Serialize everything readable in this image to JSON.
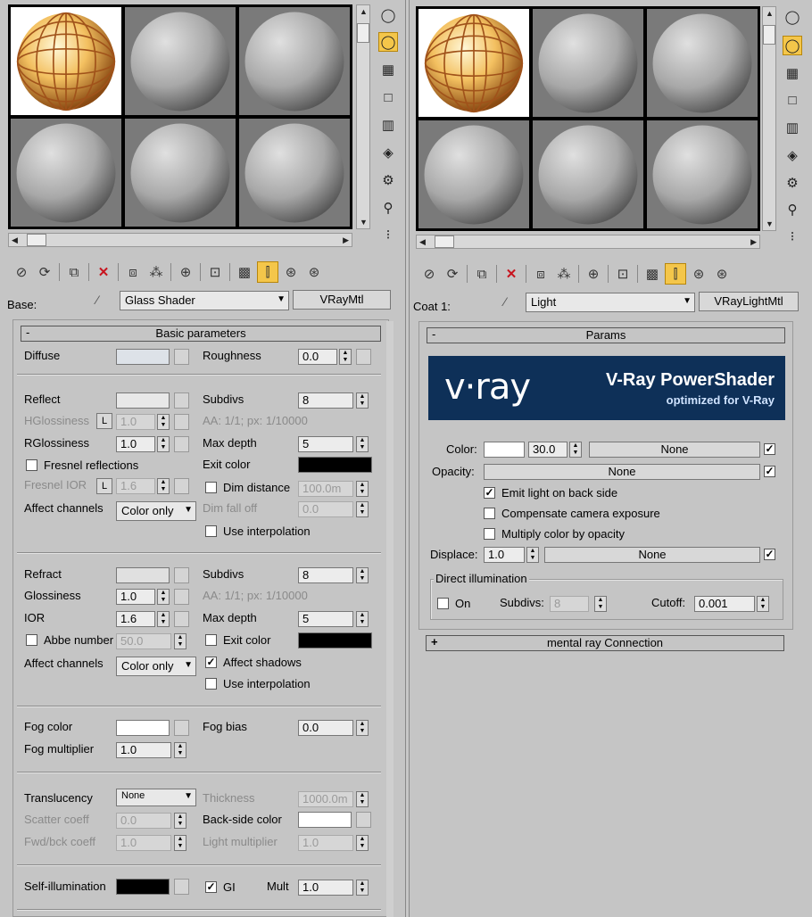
{
  "left": {
    "base_label": "Base:",
    "material_name": "Glass Shader",
    "material_type": "VRayMtl",
    "rollout_title": "Basic parameters",
    "rollout_toggle": "-",
    "diffuse": {
      "label": "Diffuse",
      "roughness_label": "Roughness",
      "roughness": "0.0",
      "color": "#dde2e8"
    },
    "reflect": {
      "label": "Reflect",
      "color": "#e8e8e8",
      "hgloss_label": "HGlossiness",
      "hgloss_lock": "L",
      "hgloss": "1.0",
      "rgloss_label": "RGlossiness",
      "rgloss": "1.0",
      "fresnel_label": "Fresnel reflections",
      "fresnel_ior_label": "Fresnel IOR",
      "fresnel_ior_lock": "L",
      "fresnel_ior": "1.6",
      "affect_label": "Affect channels",
      "affect_value": "Color only",
      "subdivs_label": "Subdivs",
      "subdivs": "8",
      "aa": "AA: 1/1; px: 1/10000",
      "maxdepth_label": "Max depth",
      "maxdepth": "5",
      "exit_label": "Exit color",
      "dim_label": "Dim distance",
      "dim_value": "100.0m",
      "dimfall_label": "Dim fall off",
      "dimfall": "0.0",
      "interp_label": "Use interpolation"
    },
    "refract": {
      "label": "Refract",
      "color": "#e0e0e0",
      "gloss_label": "Glossiness",
      "gloss": "1.0",
      "ior_label": "IOR",
      "ior": "1.6",
      "abbe_label": "Abbe number",
      "abbe": "50.0",
      "affect_label": "Affect channels",
      "affect_value": "Color only",
      "subdivs_label": "Subdivs",
      "subdivs": "8",
      "aa": "AA: 1/1; px: 1/10000",
      "maxdepth_label": "Max depth",
      "maxdepth": "5",
      "exit_label": "Exit color",
      "shadows_label": "Affect shadows",
      "interp_label": "Use interpolation"
    },
    "fog": {
      "color_label": "Fog color",
      "mult_label": "Fog multiplier",
      "mult": "1.0",
      "bias_label": "Fog bias",
      "bias": "0.0"
    },
    "transl": {
      "label": "Translucency",
      "value": "None",
      "thick_label": "Thickness",
      "thick": "1000.0m",
      "scatter_label": "Scatter coeff",
      "scatter": "0.0",
      "backside_label": "Back-side color",
      "fwd_label": "Fwd/bck coeff",
      "fwd": "1.0",
      "lightmult_label": "Light multiplier",
      "lightmult": "1.0"
    },
    "selfillum": {
      "label": "Self-illumination",
      "gi_label": "GI",
      "mult_label": "Mult",
      "mult": "1.0"
    }
  },
  "right": {
    "coat_label": "Coat 1:",
    "material_name": "Light",
    "material_type": "VRayLightMtl",
    "rollout_title": "Params",
    "rollout_toggle": "-",
    "logo_brand": "v·ray",
    "logo_title": "V-Ray PowerShader",
    "logo_sub": "optimized for V-Ray",
    "color_label": "Color:",
    "color_value": "30.0",
    "map_none": "None",
    "opacity_label": "Opacity:",
    "emit_label": "Emit light on back side",
    "compensate_label": "Compensate camera exposure",
    "multiply_label": "Multiply color by opacity",
    "displace_label": "Displace:",
    "displace_value": "1.0",
    "direct_label": "Direct illumination",
    "on_label": "On",
    "subdivs_label": "Subdivs:",
    "subdivs": "8",
    "cutoff_label": "Cutoff:",
    "cutoff": "0.001",
    "mr_title": "mental ray Connection",
    "mr_toggle": "+"
  }
}
